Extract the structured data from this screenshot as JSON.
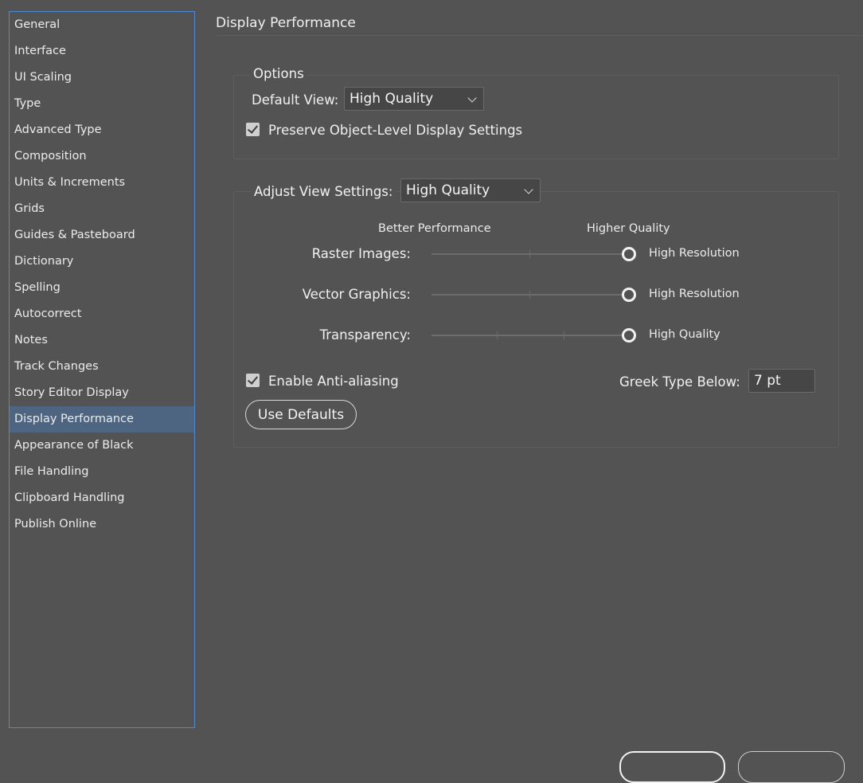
{
  "sidebar": {
    "items": [
      {
        "label": "General"
      },
      {
        "label": "Interface"
      },
      {
        "label": "UI Scaling"
      },
      {
        "label": "Type"
      },
      {
        "label": "Advanced Type"
      },
      {
        "label": "Composition"
      },
      {
        "label": "Units & Increments"
      },
      {
        "label": "Grids"
      },
      {
        "label": "Guides & Pasteboard"
      },
      {
        "label": "Dictionary"
      },
      {
        "label": "Spelling"
      },
      {
        "label": "Autocorrect"
      },
      {
        "label": "Notes"
      },
      {
        "label": "Track Changes"
      },
      {
        "label": "Story Editor Display"
      },
      {
        "label": "Display Performance"
      },
      {
        "label": "Appearance of Black"
      },
      {
        "label": "File Handling"
      },
      {
        "label": "Clipboard Handling"
      },
      {
        "label": "Publish Online"
      }
    ],
    "selected": "Display Performance"
  },
  "page": {
    "title": "Display Performance"
  },
  "options": {
    "legend": "Options",
    "default_view_label": "Default View:",
    "default_view_value": "High Quality",
    "preserve_label": "Preserve Object-Level Display Settings",
    "preserve_checked": true
  },
  "adjust": {
    "label": "Adjust View Settings:",
    "value": "High Quality",
    "scale_low": "Better Performance",
    "scale_high": "Higher Quality",
    "sliders": [
      {
        "label": "Raster Images:",
        "value_text": "High Resolution",
        "level": 1.0
      },
      {
        "label": "Vector Graphics:",
        "value_text": "High Resolution",
        "level": 1.0
      },
      {
        "label": "Transparency:",
        "value_text": "High Quality",
        "level": 1.0
      }
    ],
    "anti_alias_label": "Enable Anti-aliasing",
    "anti_alias_checked": true,
    "greek_label": "Greek Type Below:",
    "greek_value": "7 pt",
    "use_defaults_label": "Use Defaults"
  },
  "colors": {
    "background": "#535353",
    "sidebar_border": "#4a8ad6",
    "selected": "#4d6580"
  }
}
